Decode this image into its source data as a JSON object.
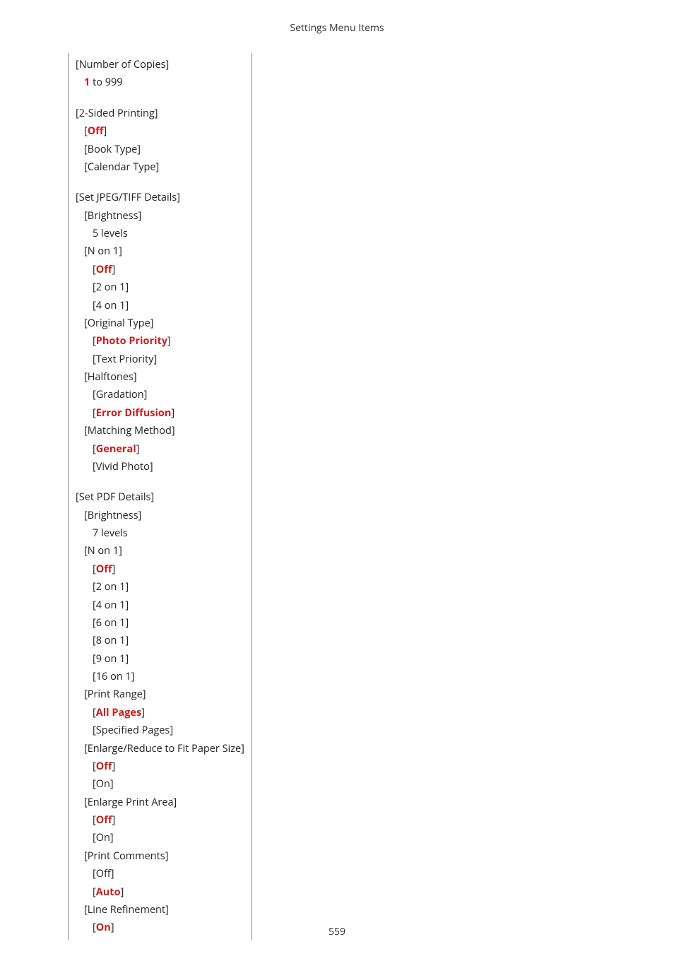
{
  "header": {
    "title": "Settings Menu Items"
  },
  "footer": {
    "page": "559"
  },
  "sections": {
    "copies": {
      "title": "[Number of Copies]",
      "range_prefix": "1",
      "range_suffix": " to 999"
    },
    "twoSided": {
      "title": "[2-Sided Printing]",
      "off": "Off",
      "book": "[Book Type]",
      "calendar": "[Calendar Type]"
    },
    "jpeg": {
      "title": "[Set JPEG/TIFF Details]",
      "brightness": {
        "label": "[Brightness]",
        "value": "5 levels"
      },
      "non1": {
        "label": "[N on 1]",
        "off": "Off",
        "o2": "[2 on 1]",
        "o4": "[4 on 1]"
      },
      "original": {
        "label": "[Original Type]",
        "photo": "Photo Priority",
        "text": "[Text Priority]"
      },
      "halftones": {
        "label": "[Halftones]",
        "gradation": "[Gradation]",
        "error": "Error Diffusion"
      },
      "matching": {
        "label": "[Matching Method]",
        "general": "General",
        "vivid": "[Vivid Photo]"
      }
    },
    "pdf": {
      "title": "[Set PDF Details]",
      "brightness": {
        "label": "[Brightness]",
        "value": "7 levels"
      },
      "non1": {
        "label": "[N on 1]",
        "off": "Off",
        "o2": "[2 on 1]",
        "o4": "[4 on 1]",
        "o6": "[6 on 1]",
        "o8": "[8 on 1]",
        "o9": "[9 on 1]",
        "o16": "[16 on 1]"
      },
      "printRange": {
        "label": "[Print Range]",
        "all": "All Pages",
        "specified": "[Specified Pages]"
      },
      "enlargeFit": {
        "label": "[Enlarge/Reduce to Fit Paper Size]",
        "off": "Off",
        "on": "[On]"
      },
      "enlargeArea": {
        "label": "[Enlarge Print Area]",
        "off": "Off",
        "on": "[On]"
      },
      "printComments": {
        "label": "[Print Comments]",
        "off": "[Off]",
        "auto": "Auto"
      },
      "lineRefine": {
        "label": "[Line Refinement]",
        "on": "On"
      }
    }
  }
}
